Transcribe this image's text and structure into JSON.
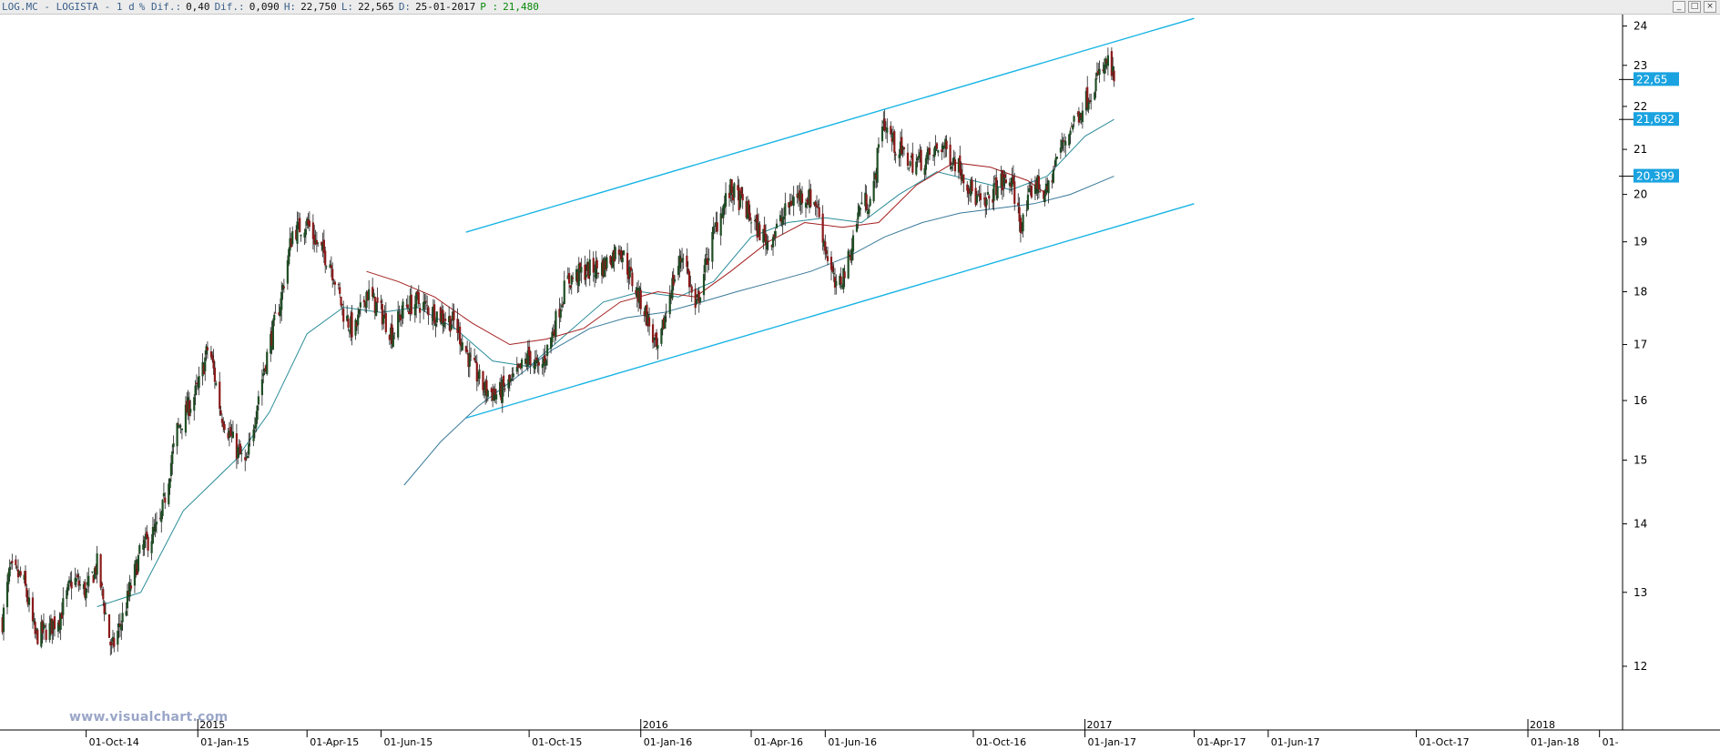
{
  "header": {
    "symbol": "LOG.MC - LOGISTA - 1 d",
    "pct_diff_label": "% Dif.:",
    "pct_diff_value": "0,40",
    "diff_label": "Dif.:",
    "diff_value": "0,090",
    "high_label": "H:",
    "high_value": "22,750",
    "low_label": "L:",
    "low_value": "22,565",
    "date_label": "D:",
    "date_value": "25-01-2017",
    "p_label": "P :",
    "p_value": "21,480"
  },
  "window_controls": [
    "_",
    "□",
    "×"
  ],
  "watermark": "www.visualchart.com",
  "chart_data": {
    "type": "candlestick",
    "title": "LOG.MC - LOGISTA - 1 d",
    "xlabel": "",
    "ylabel": "",
    "y_scale": "log",
    "ylim": [
      11.2,
      24.3
    ],
    "xlim": [
      "2014-07-22",
      "2018-03-20"
    ],
    "grid": false,
    "y_ticks": [
      "24",
      "23",
      "22",
      "21",
      "20",
      "19",
      "18",
      "17",
      "16",
      "15",
      "14",
      "13",
      "12"
    ],
    "y_tick_values": [
      24,
      23,
      22,
      21,
      20,
      19,
      18,
      17,
      16,
      15,
      14,
      13,
      12
    ],
    "x_ticks": [
      {
        "date": "2014-10-01",
        "label": "01-Oct-14"
      },
      {
        "date": "2015-01-01",
        "label": "01-Jan-15"
      },
      {
        "date": "2015-04-01",
        "label": "01-Apr-15"
      },
      {
        "date": "2015-06-01",
        "label": "01-Jun-15"
      },
      {
        "date": "2015-10-01",
        "label": "01-Oct-15"
      },
      {
        "date": "2016-01-01",
        "label": "01-Jan-16"
      },
      {
        "date": "2016-04-01",
        "label": "01-Apr-16"
      },
      {
        "date": "2016-06-01",
        "label": "01-Jun-16"
      },
      {
        "date": "2016-10-01",
        "label": "01-Oct-16"
      },
      {
        "date": "2017-01-01",
        "label": "01-Jan-17"
      },
      {
        "date": "2017-04-01",
        "label": "01-Apr-17"
      },
      {
        "date": "2017-06-01",
        "label": "01-Jun-17"
      },
      {
        "date": "2017-10-01",
        "label": "01-Oct-17"
      },
      {
        "date": "2018-01-01",
        "label": "01-Jan-18"
      },
      {
        "date": "2018-03-01",
        "label": "01-"
      }
    ],
    "year_markers": [
      {
        "date": "2015-01-01",
        "label": "2015"
      },
      {
        "date": "2016-01-01",
        "label": "2016"
      },
      {
        "date": "2017-01-01",
        "label": "2017"
      },
      {
        "date": "2018-01-01",
        "label": "2018"
      }
    ],
    "price_keypoints": [
      [
        "2014-07-24",
        12.6
      ],
      [
        "2014-07-30",
        13.3
      ],
      [
        "2014-08-10",
        13.2
      ],
      [
        "2014-08-20",
        12.4
      ],
      [
        "2014-09-01",
        12.5
      ],
      [
        "2014-09-10",
        12.7
      ],
      [
        "2014-09-20",
        13.2
      ],
      [
        "2014-10-01",
        13.0
      ],
      [
        "2014-10-10",
        13.4
      ],
      [
        "2014-10-22",
        12.2
      ],
      [
        "2014-11-01",
        12.7
      ],
      [
        "2014-11-15",
        13.6
      ],
      [
        "2014-12-01",
        14.0
      ],
      [
        "2014-12-15",
        15.5
      ],
      [
        "2015-01-01",
        16.2
      ],
      [
        "2015-01-10",
        17.0
      ],
      [
        "2015-01-20",
        15.8
      ],
      [
        "2015-02-01",
        15.2
      ],
      [
        "2015-02-10",
        14.9
      ],
      [
        "2015-02-20",
        16.1
      ],
      [
        "2015-03-01",
        17.0
      ],
      [
        "2015-03-10",
        17.8
      ],
      [
        "2015-03-20",
        19.2
      ],
      [
        "2015-04-01",
        19.4
      ],
      [
        "2015-04-10",
        18.9
      ],
      [
        "2015-04-20",
        18.6
      ],
      [
        "2015-05-01",
        17.6
      ],
      [
        "2015-05-10",
        17.2
      ],
      [
        "2015-05-20",
        18.0
      ],
      [
        "2015-06-01",
        17.6
      ],
      [
        "2015-06-10",
        17.2
      ],
      [
        "2015-06-20",
        17.7
      ],
      [
        "2015-07-01",
        17.8
      ],
      [
        "2015-07-15",
        17.6
      ],
      [
        "2015-08-01",
        17.4
      ],
      [
        "2015-08-15",
        16.6
      ],
      [
        "2015-08-25",
        16.2
      ],
      [
        "2015-09-05",
        16.1
      ],
      [
        "2015-09-20",
        16.4
      ],
      [
        "2015-10-01",
        16.8
      ],
      [
        "2015-10-10",
        16.5
      ],
      [
        "2015-10-20",
        17.2
      ],
      [
        "2015-11-01",
        18.2
      ],
      [
        "2015-11-15",
        18.4
      ],
      [
        "2015-12-01",
        18.5
      ],
      [
        "2015-12-15",
        18.9
      ],
      [
        "2015-12-25",
        18.2
      ],
      [
        "2016-01-05",
        17.6
      ],
      [
        "2016-01-15",
        16.8
      ],
      [
        "2016-01-25",
        18.0
      ],
      [
        "2016-02-05",
        18.8
      ],
      [
        "2016-02-15",
        17.6
      ],
      [
        "2016-02-25",
        18.7
      ],
      [
        "2016-03-05",
        19.5
      ],
      [
        "2016-03-15",
        20.1
      ],
      [
        "2016-03-25",
        19.8
      ],
      [
        "2016-04-05",
        19.3
      ],
      [
        "2016-04-15",
        19.0
      ],
      [
        "2016-04-25",
        19.4
      ],
      [
        "2016-05-05",
        19.9
      ],
      [
        "2016-05-15",
        20.0
      ],
      [
        "2016-05-25",
        19.8
      ],
      [
        "2016-06-01",
        18.9
      ],
      [
        "2016-06-10",
        18.0
      ],
      [
        "2016-06-20",
        18.6
      ],
      [
        "2016-06-30",
        19.8
      ],
      [
        "2016-07-10",
        19.9
      ],
      [
        "2016-07-18",
        21.7
      ],
      [
        "2016-07-28",
        21.1
      ],
      [
        "2016-08-10",
        20.7
      ],
      [
        "2016-08-25",
        20.8
      ],
      [
        "2016-09-05",
        21.1
      ],
      [
        "2016-09-20",
        20.6
      ],
      [
        "2016-10-01",
        20.0
      ],
      [
        "2016-10-10",
        19.7
      ],
      [
        "2016-10-20",
        20.2
      ],
      [
        "2016-11-01",
        20.3
      ],
      [
        "2016-11-10",
        19.3
      ],
      [
        "2016-11-20",
        20.3
      ],
      [
        "2016-11-30",
        20.0
      ],
      [
        "2016-12-10",
        20.9
      ],
      [
        "2016-12-20",
        21.5
      ],
      [
        "2016-12-30",
        22.0
      ],
      [
        "2017-01-10",
        22.6
      ],
      [
        "2017-01-20",
        23.1
      ],
      [
        "2017-01-25",
        22.65
      ]
    ],
    "moving_averages": [
      {
        "color": "#2a8c98",
        "points": [
          [
            "2014-10-10",
            12.8
          ],
          [
            "2014-11-15",
            13.0
          ],
          [
            "2014-12-20",
            14.2
          ],
          [
            "2015-02-01",
            15.0
          ],
          [
            "2015-03-01",
            15.8
          ],
          [
            "2015-04-01",
            17.2
          ],
          [
            "2015-05-01",
            17.7
          ],
          [
            "2015-06-01",
            17.6
          ],
          [
            "2015-07-01",
            17.7
          ],
          [
            "2015-08-01",
            17.3
          ],
          [
            "2015-09-01",
            16.7
          ],
          [
            "2015-10-01",
            16.6
          ],
          [
            "2015-11-01",
            17.2
          ],
          [
            "2015-12-01",
            17.8
          ],
          [
            "2016-01-01",
            18.0
          ],
          [
            "2016-02-01",
            17.9
          ],
          [
            "2016-03-01",
            18.2
          ],
          [
            "2016-04-01",
            19.1
          ],
          [
            "2016-05-01",
            19.4
          ],
          [
            "2016-06-01",
            19.5
          ],
          [
            "2016-07-01",
            19.4
          ],
          [
            "2016-08-01",
            20.0
          ],
          [
            "2016-09-01",
            20.5
          ],
          [
            "2016-10-01",
            20.3
          ],
          [
            "2016-11-01",
            20.1
          ],
          [
            "2016-12-01",
            20.4
          ],
          [
            "2017-01-01",
            21.3
          ],
          [
            "2017-01-25",
            21.692
          ]
        ]
      },
      {
        "color": "#a42020",
        "points": [
          [
            "2015-05-20",
            18.4
          ],
          [
            "2015-06-15",
            18.2
          ],
          [
            "2015-07-15",
            17.9
          ],
          [
            "2015-08-15",
            17.4
          ],
          [
            "2015-09-15",
            17.0
          ],
          [
            "2015-10-15",
            17.1
          ],
          [
            "2015-11-15",
            17.3
          ],
          [
            "2015-12-15",
            17.8
          ],
          [
            "2016-01-15",
            18.0
          ],
          [
            "2016-02-15",
            17.9
          ],
          [
            "2016-03-15",
            18.4
          ],
          [
            "2016-04-15",
            19.0
          ],
          [
            "2016-05-15",
            19.4
          ],
          [
            "2016-06-15",
            19.3
          ],
          [
            "2016-07-15",
            19.4
          ],
          [
            "2016-08-15",
            20.2
          ],
          [
            "2016-09-15",
            20.7
          ],
          [
            "2016-10-15",
            20.6
          ],
          [
            "2016-11-15",
            20.3
          ],
          [
            "2016-12-01",
            20.0
          ]
        ]
      },
      {
        "color": "#3a7a9a",
        "points": [
          [
            "2015-06-20",
            14.6
          ],
          [
            "2015-07-20",
            15.3
          ],
          [
            "2015-08-20",
            15.9
          ],
          [
            "2015-09-20",
            16.4
          ],
          [
            "2015-10-20",
            16.9
          ],
          [
            "2015-11-20",
            17.3
          ],
          [
            "2015-12-20",
            17.5
          ],
          [
            "2016-01-20",
            17.6
          ],
          [
            "2016-02-20",
            17.8
          ],
          [
            "2016-03-20",
            18.0
          ],
          [
            "2016-04-20",
            18.2
          ],
          [
            "2016-05-20",
            18.4
          ],
          [
            "2016-06-20",
            18.7
          ],
          [
            "2016-07-20",
            19.1
          ],
          [
            "2016-08-20",
            19.4
          ],
          [
            "2016-09-20",
            19.6
          ],
          [
            "2016-10-20",
            19.7
          ],
          [
            "2016-11-20",
            19.8
          ],
          [
            "2016-12-20",
            20.0
          ],
          [
            "2017-01-25",
            20.399
          ]
        ]
      }
    ],
    "trend_channel": {
      "color": "#18b4e4",
      "upper": [
        [
          "2015-08-10",
          19.2
        ],
        [
          "2017-04-01",
          24.2
        ]
      ],
      "lower": [
        [
          "2015-08-10",
          15.7
        ],
        [
          "2017-04-01",
          19.8
        ]
      ]
    },
    "price_badges": [
      {
        "value": 22.65,
        "label": "22,65"
      },
      {
        "value": 21.692,
        "label": "21,692"
      },
      {
        "value": 20.399,
        "label": "20,399"
      }
    ]
  }
}
